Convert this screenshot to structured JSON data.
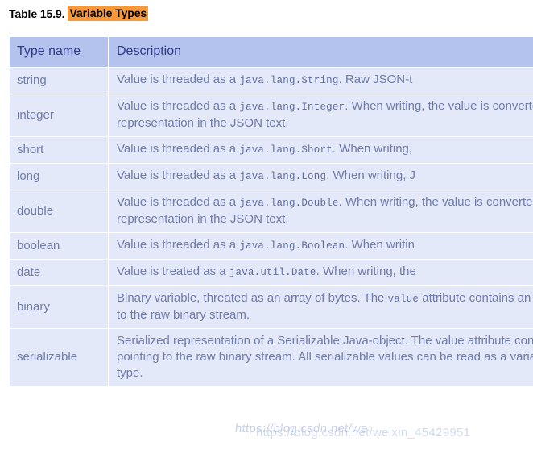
{
  "caption": {
    "label": "Table 15.9.",
    "title": "Variable Types",
    "highlight_color": "#f79939"
  },
  "table": {
    "columns": [
      "Type name",
      "Description"
    ],
    "header_bg": "#b4c2ee",
    "header_text_color": "#2b3a8f",
    "row_bg": "#e4e9fa",
    "row_text_color": "#6f7ba8",
    "rows": [
      {
        "type": "string",
        "desc_parts": [
          {
            "text": "Value is threaded as a ",
            "style": "normal"
          },
          {
            "text": "java.lang.String",
            "style": "mono"
          },
          {
            "text": ". Raw JSON-t",
            "style": "normal"
          }
        ]
      },
      {
        "type": "integer",
        "desc_parts": [
          {
            "text": "Value is threaded as a ",
            "style": "normal"
          },
          {
            "text": "java.lang.Integer",
            "style": "mono"
          },
          {
            "text": ". When writing, the value is converted to its string representation in the JSON text.",
            "style": "normal"
          }
        ]
      },
      {
        "type": "short",
        "desc_parts": [
          {
            "text": "Value is threaded as a ",
            "style": "normal"
          },
          {
            "text": "java.lang.Short",
            "style": "mono"
          },
          {
            "text": ". When writing,",
            "style": "normal"
          }
        ]
      },
      {
        "type": "long",
        "desc_parts": [
          {
            "text": "Value is threaded as a ",
            "style": "normal"
          },
          {
            "text": "java.lang.Long",
            "style": "mono"
          },
          {
            "text": ". When writing, J",
            "style": "normal"
          }
        ]
      },
      {
        "type": "double",
        "desc_parts": [
          {
            "text": "Value is threaded as a ",
            "style": "normal"
          },
          {
            "text": "java.lang.Double",
            "style": "mono"
          },
          {
            "text": ". When writing, the value is converted to its string representation in the JSON text.",
            "style": "normal"
          }
        ]
      },
      {
        "type": "boolean",
        "desc_parts": [
          {
            "text": "Value is threaded as a ",
            "style": "normal"
          },
          {
            "text": "java.lang.Boolean",
            "style": "mono"
          },
          {
            "text": ". When writin",
            "style": "normal"
          }
        ]
      },
      {
        "type": "date",
        "desc_parts": [
          {
            "text": "Value is treated as a ",
            "style": "normal"
          },
          {
            "text": "java.util.Date",
            "style": "mono"
          },
          {
            "text": ". When writing, the",
            "style": "normal"
          }
        ]
      },
      {
        "type": "binary",
        "desc_parts": [
          {
            "text": "Binary variable, threated as an array of bytes. The ",
            "style": "normal"
          },
          {
            "text": "value",
            "style": "mono"
          },
          {
            "text": " attribute contains an URL pointing to the raw binary stream.",
            "style": "normal"
          }
        ]
      },
      {
        "type": "serializable",
        "desc_parts": [
          {
            "text": "Serialized representation of a Serializable Java-object. The value attribute contains an URL pointing to the raw binary stream. All serializable values can be read as a variable of this type.",
            "style": "normal"
          }
        ]
      }
    ]
  },
  "watermark": {
    "line_a": "https://blog.csdn.net/we",
    "line_b": "https://blog.csdn.net/weixin_45429951"
  }
}
